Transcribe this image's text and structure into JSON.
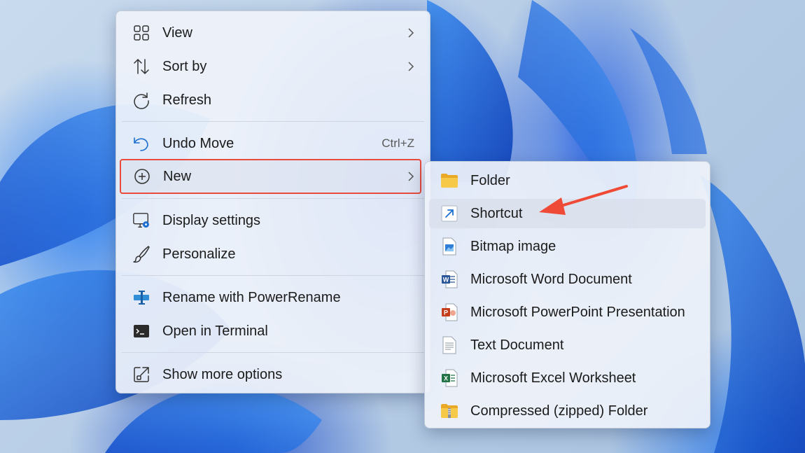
{
  "main_menu": {
    "items": [
      {
        "label": "View",
        "icon": "view-grid-icon",
        "submenu": true
      },
      {
        "label": "Sort by",
        "icon": "sort-icon",
        "submenu": true
      },
      {
        "label": "Refresh",
        "icon": "refresh-icon"
      },
      {
        "label": "Undo Move",
        "icon": "undo-icon",
        "shortcut": "Ctrl+Z"
      },
      {
        "label": "New",
        "icon": "new-plus-icon",
        "submenu": true
      },
      {
        "label": "Display settings",
        "icon": "display-settings-icon"
      },
      {
        "label": "Personalize",
        "icon": "brush-icon"
      },
      {
        "label": "Rename with PowerRename",
        "icon": "powerrename-icon"
      },
      {
        "label": "Open in Terminal",
        "icon": "terminal-icon"
      },
      {
        "label": "Show more options",
        "icon": "show-more-icon"
      }
    ]
  },
  "sub_menu": {
    "items": [
      {
        "label": "Folder",
        "icon": "folder-icon"
      },
      {
        "label": "Shortcut",
        "icon": "shortcut-icon"
      },
      {
        "label": "Bitmap image",
        "icon": "bitmap-icon"
      },
      {
        "label": "Microsoft Word Document",
        "icon": "word-icon"
      },
      {
        "label": "Microsoft PowerPoint Presentation",
        "icon": "powerpoint-icon"
      },
      {
        "label": "Text Document",
        "icon": "text-document-icon"
      },
      {
        "label": "Microsoft Excel Worksheet",
        "icon": "excel-icon"
      },
      {
        "label": "Compressed (zipped) Folder",
        "icon": "zip-folder-icon"
      }
    ]
  },
  "colors": {
    "highlight_border": "#e84b3c",
    "arrow": "#ef4a36",
    "menu_bg": "#eef2fa",
    "word": "#2b579a",
    "powerpoint": "#c43e1c",
    "excel": "#217346",
    "folder": "#f4c542"
  }
}
